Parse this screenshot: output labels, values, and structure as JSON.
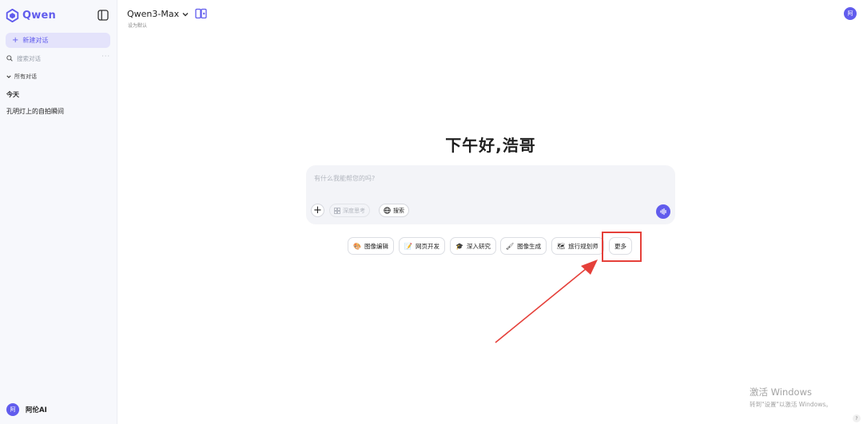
{
  "sidebar": {
    "brand": "Qwen",
    "new_chat_label": "新建对话",
    "search_placeholder": "搜索对话",
    "search_more": "···",
    "all_chats_label": "所有对话",
    "groups": [
      {
        "label": "今天",
        "items": [
          "孔明灯上的自拍瞬间"
        ]
      }
    ],
    "user": {
      "avatar_text": "阿",
      "name": "阿伦AI"
    }
  },
  "header": {
    "model_name": "Qwen3-Max",
    "set_default": "设为默认",
    "avatar_text": "阿"
  },
  "main": {
    "greeting": "下午好,浩哥",
    "input_placeholder": "有什么我能帮您的吗?",
    "think_label": "深度思考",
    "search_label": "搜索",
    "chips": [
      {
        "icon": "palette-icon",
        "emoji": "🎨",
        "label": "图像编辑"
      },
      {
        "icon": "web-dev-icon",
        "emoji": "📝",
        "label": "网页开发"
      },
      {
        "icon": "graduation-cap-icon",
        "emoji": "🎓",
        "label": "深入研究"
      },
      {
        "icon": "image-gen-icon",
        "emoji": "🖌",
        "label": "图像生成"
      },
      {
        "icon": "map-icon",
        "emoji": "🗺",
        "label": "旅行规划师"
      },
      {
        "icon": "",
        "emoji": "",
        "label": "更多"
      }
    ]
  },
  "watermark": {
    "title": "激活 Windows",
    "subtitle": "转到\"设置\"以激活 Windows。"
  },
  "help_label": "?",
  "colors": {
    "accent": "#615ced",
    "annotation": "#e5403a"
  }
}
